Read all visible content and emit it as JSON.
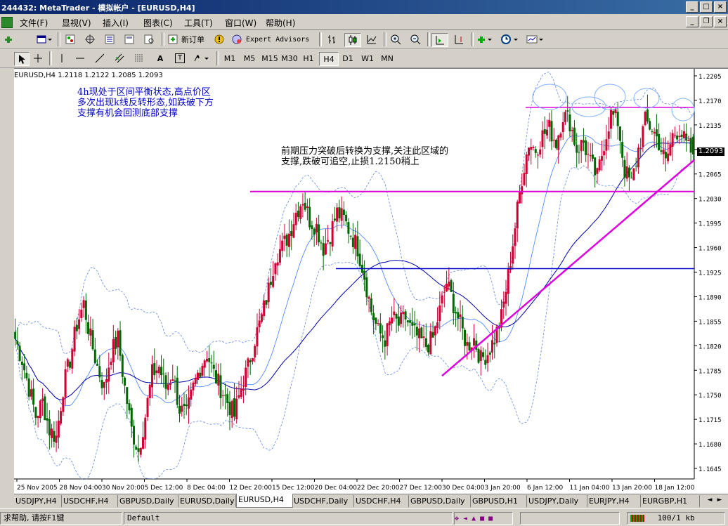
{
  "window": {
    "title": "244432: MetaTrader - 模拟帐户 - [EURUSD,H4]",
    "min_label": "_",
    "max_label": "□",
    "close_label": "×",
    "restore_label": "❐"
  },
  "menu": {
    "items": [
      "文件(F)",
      "显视(V)",
      "插入(I)",
      "图表(C)",
      "工具(T)",
      "窗口(W)",
      "帮助(H)"
    ]
  },
  "toolbar1": {
    "new_order_label": "新订单",
    "expert_advisors_label": "Expert Advisors"
  },
  "toolbar2": {
    "text_tool": "A",
    "label_tool": "T",
    "timeframes": [
      "M1",
      "M5",
      "M15",
      "M30",
      "H1",
      "H4",
      "D1",
      "W1",
      "MN"
    ],
    "active_timeframe": "H4"
  },
  "chart": {
    "header": "EURUSD,H4  1.2118 1.2122 1.2085 1.2093",
    "current_price_label": "1.2093",
    "annotation_left": "4h现处于区间平衡状态,高点价区\n多次出现k线反转形态,如跌破下方\n支撑有机会回测底部支撑",
    "annotation_right": "前期压力突破后转换为支撑,关注此区域的\n支撑,跌破可追空,止损1.2150稍上",
    "colors": {
      "bull": "#cc0033",
      "bear": "#006600",
      "ma_slow": "#0000aa",
      "ma_fast": "#4080ff",
      "bands": "#6688dd",
      "magenta": "#dd00dd",
      "blue_line": "#0000cc"
    }
  },
  "chart_data": {
    "type": "candlestick",
    "symbol": "EURUSD",
    "timeframe": "H4",
    "y_ticks": [
      "1.2205",
      "1.2170",
      "1.2135",
      "1.2100",
      "1.2065",
      "1.2030",
      "1.1995",
      "1.1960",
      "1.1925",
      "1.1890",
      "1.1855",
      "1.1820",
      "1.1785",
      "1.1750",
      "1.1715",
      "1.1680",
      "1.1645"
    ],
    "x_ticks": [
      "25 Nov 2005",
      "28 Nov 04:00",
      "30 Nov 20:00",
      "5 Dec 12:00",
      "8 Dec 04:00",
      "12 Dec 20:00",
      "15 Dec 12:00",
      "20 Dec 04:00",
      "22 Dec 20:00",
      "27 Dec 12:00",
      "30 Dec 04:00",
      "3 Jan 20:00",
      "6 Jan 12:00",
      "11 Jan 04:00",
      "13 Jan 20:00",
      "18 Jan 12:00"
    ],
    "ylim": [
      1.163,
      1.2215
    ],
    "last": {
      "open": 1.2118,
      "high": 1.2122,
      "low": 1.2085,
      "close": 1.2093
    },
    "levels": {
      "resistance": 1.216,
      "range_support": 1.204,
      "prior_breakout": 1.193
    },
    "trendline": {
      "from": [
        "30 Dec 04:00",
        1.1777
      ],
      "to": [
        "18 Jan 12:00",
        1.208
      ]
    },
    "close_path": [
      1.183,
      1.18,
      1.176,
      1.172,
      1.174,
      1.17,
      1.169,
      1.176,
      1.18,
      1.185,
      1.188,
      1.183,
      1.179,
      1.176,
      1.181,
      1.183,
      1.176,
      1.17,
      1.167,
      1.172,
      1.178,
      1.179,
      1.176,
      1.178,
      1.173,
      1.172,
      1.176,
      1.179,
      1.181,
      1.178,
      1.176,
      1.174,
      1.172,
      1.176,
      1.179,
      1.183,
      1.186,
      1.19,
      1.195,
      1.196,
      1.198,
      1.201,
      1.203,
      1.2,
      1.199,
      1.196,
      1.198,
      1.201,
      1.2,
      1.198,
      1.196,
      1.192,
      1.187,
      1.184,
      1.183,
      1.186,
      1.185,
      1.186,
      1.184,
      1.183,
      1.182,
      1.183,
      1.187,
      1.191,
      1.188,
      1.185,
      1.182,
      1.183,
      1.18,
      1.181,
      1.183,
      1.186,
      1.192,
      1.199,
      1.206,
      1.211,
      1.21,
      1.212,
      1.213,
      1.211,
      1.215,
      1.214,
      1.21,
      1.211,
      1.208,
      1.206,
      1.211,
      1.215,
      1.214,
      1.207,
      1.205,
      1.21,
      1.214,
      1.213,
      1.211,
      1.208,
      1.212,
      1.213,
      1.2105,
      1.2093
    ]
  },
  "tabs": [
    "USDJPY,H4",
    "USDCHF,H4",
    "GBPUSD,Daily",
    "EURUSD,Daily",
    "EURUSD,H4",
    "USDCHF,Daily",
    "USDCHF,H4",
    "GBPUSD,Daily",
    "GBPUSD,H1",
    "USDJPY,Daily",
    "EURJPY,H4",
    "EURGBP,H1"
  ],
  "active_tab": "EURUSD,H4",
  "status": {
    "help": "求帮助, 请按F1键",
    "profile": "Default",
    "traffic": "100/1 kb"
  }
}
